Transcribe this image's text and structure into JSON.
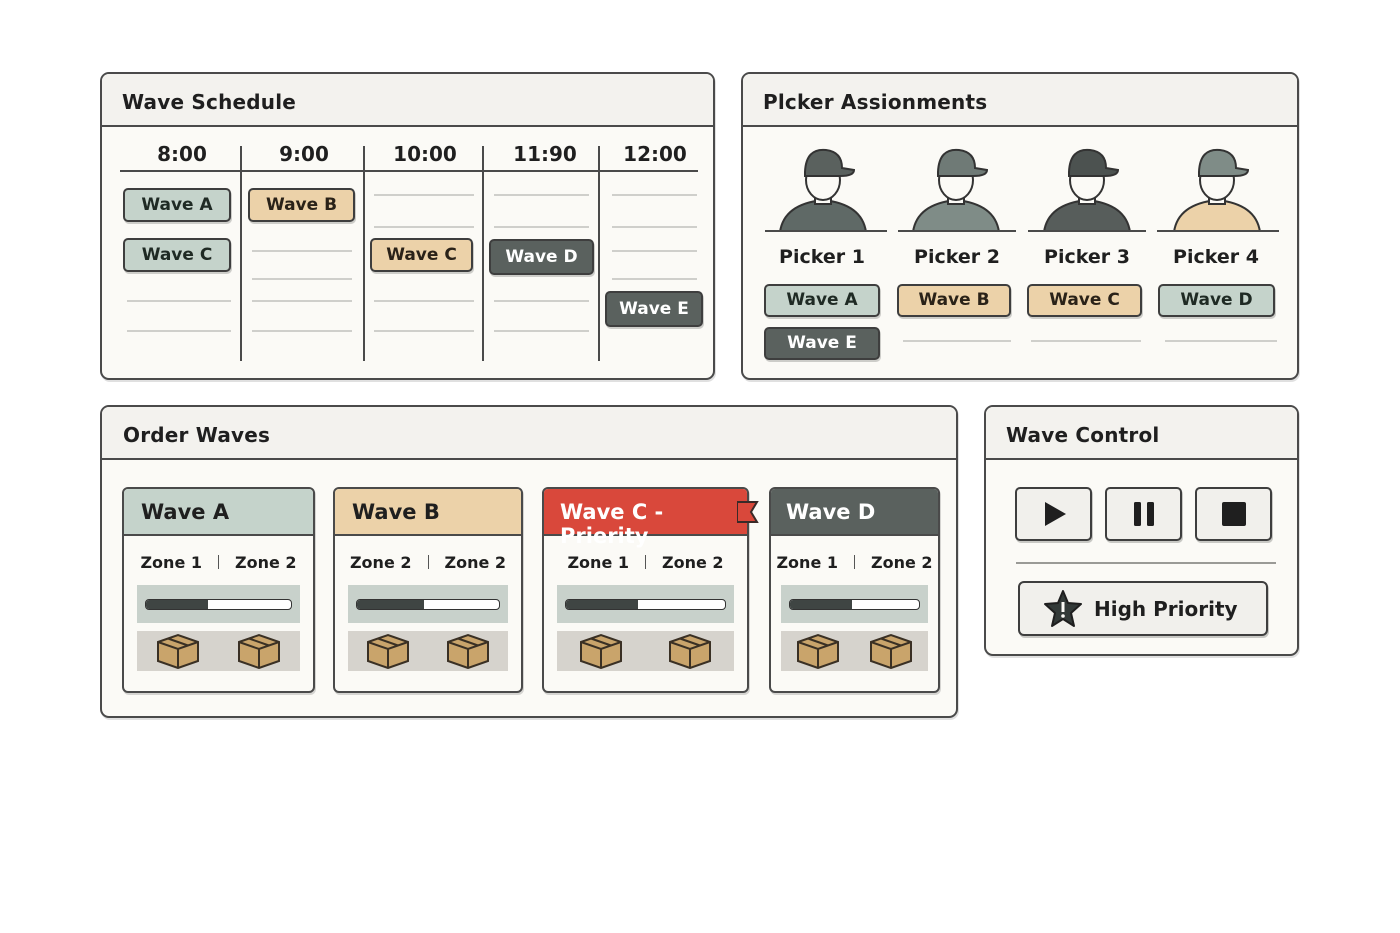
{
  "colors": {
    "sage": "#c5d3cb",
    "tan": "#ecd2a9",
    "dark": "#5a615e",
    "priority_red": "#d9483b"
  },
  "schedule": {
    "title": "Wave Schedule",
    "times": [
      "8:00",
      "9:00",
      "10:00",
      "11:90",
      "12:00"
    ],
    "blocks": [
      {
        "label": "Wave A",
        "color": "sage"
      },
      {
        "label": "Wave C",
        "color": "sage"
      },
      {
        "label": "Wave B",
        "color": "tan"
      },
      {
        "label": "Wave C",
        "color": "tan"
      },
      {
        "label": "Wave D",
        "color": "dark"
      },
      {
        "label": "Wave E",
        "color": "dark"
      }
    ]
  },
  "pickers": {
    "title": "Plcker Assionments",
    "items": [
      {
        "name": "Picker 1",
        "shirt": "sage",
        "waves": [
          "Wave A",
          "Wave E"
        ]
      },
      {
        "name": "Picker 2",
        "shirt": "sage",
        "waves": [
          "Wave B"
        ]
      },
      {
        "name": "Picker 3",
        "shirt": "dark",
        "waves": [
          "Wave C"
        ]
      },
      {
        "name": "Picker 4",
        "shirt": "tan",
        "waves": [
          "Wave D"
        ]
      }
    ]
  },
  "order_waves": {
    "title": "Order Waves",
    "cards": [
      {
        "title": "Wave A",
        "zone_a": "Zone 1",
        "zone_b": "Zone 2",
        "progress": 0.43,
        "color": "sage"
      },
      {
        "title": "Wave B",
        "zone_a": "Zone 2",
        "zone_b": "Zone 2",
        "progress": 0.47,
        "color": "tan"
      },
      {
        "title": "Wave C - Prierity",
        "zone_a": "Zone 1",
        "zone_b": "Zone 2",
        "progress": 0.45,
        "color": "priority_red"
      },
      {
        "title": "Wave D",
        "zone_a": "Zone 1",
        "zone_b": "Zone 2",
        "progress": 0.48,
        "color": "dark"
      }
    ]
  },
  "wave_control": {
    "title": "Wave Control",
    "buttons": [
      "play-icon",
      "pause-icon",
      "stop-icon"
    ],
    "priority_label": "High Priority"
  }
}
